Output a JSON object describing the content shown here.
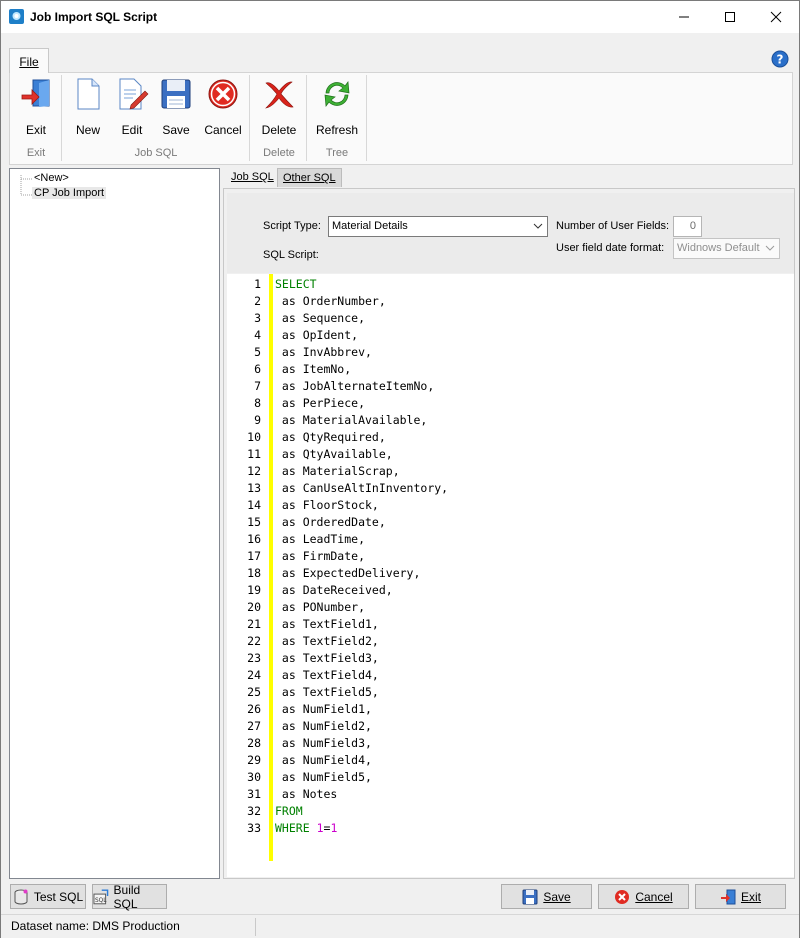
{
  "window": {
    "title": "Job Import SQL Script"
  },
  "ribbon": {
    "tab_file": "File",
    "buttons": {
      "exit": "Exit",
      "new": "New",
      "edit": "Edit",
      "save": "Save",
      "cancel": "Cancel",
      "delete": "Delete",
      "refresh": "Refresh"
    },
    "groups": {
      "exit": "Exit",
      "job_sql": "Job SQL",
      "delete": "Delete",
      "tree": "Tree"
    }
  },
  "tree": {
    "items": [
      "<New>",
      "CP Job Import"
    ]
  },
  "tabs": {
    "job_sql": "Job SQL",
    "other_sql": "Other SQL"
  },
  "settings": {
    "script_type_label": "Script Type:",
    "script_type_value": "Material Details",
    "sql_script_label": "SQL Script:",
    "num_user_fields_label": "Number of User Fields:",
    "num_user_fields_value": "0",
    "date_format_label": "User field date format:",
    "date_format_value": "Widnows Default"
  },
  "code": {
    "lines": [
      {
        "n": "1",
        "kw": "SELECT",
        "rest": ""
      },
      {
        "n": "2",
        "rest": " as OrderNumber,"
      },
      {
        "n": "3",
        "rest": " as Sequence,"
      },
      {
        "n": "4",
        "rest": " as OpIdent,"
      },
      {
        "n": "5",
        "rest": " as InvAbbrev,"
      },
      {
        "n": "6",
        "rest": " as ItemNo,"
      },
      {
        "n": "7",
        "rest": " as JobAlternateItemNo,"
      },
      {
        "n": "8",
        "rest": " as PerPiece,"
      },
      {
        "n": "9",
        "rest": " as MaterialAvailable,"
      },
      {
        "n": "10",
        "rest": " as QtyRequired,"
      },
      {
        "n": "11",
        "rest": " as QtyAvailable,"
      },
      {
        "n": "12",
        "rest": " as MaterialScrap,"
      },
      {
        "n": "13",
        "rest": " as CanUseAltInInventory,"
      },
      {
        "n": "14",
        "rest": " as FloorStock,"
      },
      {
        "n": "15",
        "rest": " as OrderedDate,"
      },
      {
        "n": "16",
        "rest": " as LeadTime,"
      },
      {
        "n": "17",
        "rest": " as FirmDate,"
      },
      {
        "n": "18",
        "rest": " as ExpectedDelivery,"
      },
      {
        "n": "19",
        "rest": " as DateReceived,"
      },
      {
        "n": "20",
        "rest": " as PONumber,"
      },
      {
        "n": "21",
        "rest": " as TextField1,"
      },
      {
        "n": "22",
        "rest": " as TextField2,"
      },
      {
        "n": "23",
        "rest": " as TextField3,"
      },
      {
        "n": "24",
        "rest": " as TextField4,"
      },
      {
        "n": "25",
        "rest": " as TextField5,"
      },
      {
        "n": "26",
        "rest": " as NumField1,"
      },
      {
        "n": "27",
        "rest": " as NumField2,"
      },
      {
        "n": "28",
        "rest": " as NumField3,"
      },
      {
        "n": "29",
        "rest": " as NumField4,"
      },
      {
        "n": "30",
        "rest": " as NumField5,"
      },
      {
        "n": "31",
        "rest": " as Notes"
      },
      {
        "n": "32",
        "kw": "FROM",
        "rest": ""
      },
      {
        "n": "33",
        "kw": "WHERE",
        "rest": " ",
        "num1": "1",
        "eq": "=",
        "num2": "1"
      }
    ]
  },
  "footer": {
    "test_sql": "Test SQL",
    "build_sql": "Build SQL",
    "save": "Save",
    "cancel": "Cancel",
    "exit": "Exit"
  },
  "status": {
    "dataset": "Dataset name:  DMS Production"
  },
  "colors": {
    "keyword": "#008000",
    "number": "#cc00cc",
    "gutter_highlight": "#ffff00"
  }
}
